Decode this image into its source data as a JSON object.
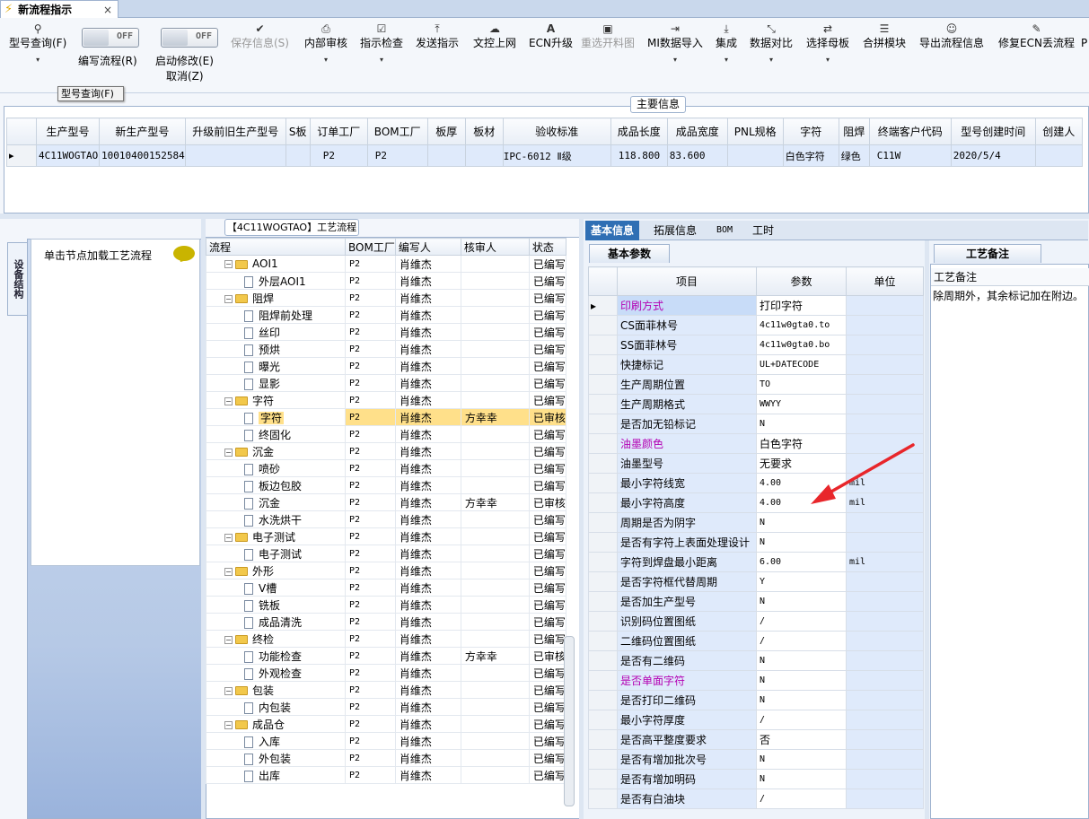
{
  "tab": {
    "title": "新流程指示",
    "close": "×"
  },
  "toolbar": {
    "query": {
      "label": "型号查询(F)",
      "icon": "search-icon"
    },
    "edit_flow": {
      "toggle": "OFF",
      "label": "编写流程(R)"
    },
    "start_modify": {
      "toggle": "OFF",
      "label": "启动修改(E)",
      "label2": "取消(Z)"
    },
    "buttons": [
      {
        "label": "保存信息(S)",
        "icon": "check-icon",
        "disabled": true
      },
      {
        "label": "内部审核",
        "icon": "print-icon"
      },
      {
        "label": "指示检查",
        "icon": "checkbox-icon"
      },
      {
        "label": "发送指示",
        "icon": "upload-icon"
      },
      {
        "label": "文控上网",
        "icon": "cloud-upload-icon"
      },
      {
        "label": "ECN升级",
        "icon": "text-icon"
      },
      {
        "label": "重选开料图",
        "icon": "image-icon",
        "disabled": true
      },
      {
        "label": "MI数据导入",
        "icon": "import-icon"
      },
      {
        "label": "集成",
        "icon": "download-icon"
      },
      {
        "label": "数据对比",
        "icon": "compress-icon"
      },
      {
        "label": "选择母板",
        "icon": "shuffle-icon"
      },
      {
        "label": "合拼模块",
        "icon": "list-icon"
      },
      {
        "label": "导出流程信息",
        "icon": "smile-icon"
      },
      {
        "label": "修复ECN丢流程",
        "icon": "wrench-icon"
      },
      {
        "label": "P",
        "icon": "more-icon"
      }
    ],
    "dropdown": "▾",
    "tooltip": "型号查询(F)"
  },
  "main_info": {
    "title": "主要信息",
    "columns": [
      "生产型号",
      "新生产型号",
      "升级前旧生产型号",
      "S板",
      "订单工厂",
      "BOM工厂",
      "板厚",
      "板材",
      "验收标准",
      "成品长度",
      "成品宽度",
      "PNL规格",
      "字符",
      "阻焊",
      "终端客户代码",
      "型号创建时间",
      "创建人"
    ],
    "row": [
      "4C11WOGTAO",
      "10010400152584",
      "",
      "",
      "P2",
      "P2",
      "",
      "",
      "IPC-6012 Ⅱ级",
      "118.800",
      "83.600",
      "",
      "白色字符",
      "绿色",
      "C11W",
      "2020/5/4",
      ""
    ]
  },
  "left_panel": {
    "vertical_tab": "设备结构",
    "hint": "单击节点加载工艺流程"
  },
  "flow": {
    "title": "【4C11WOGTAO】工艺流程",
    "columns": [
      "流程",
      "BOM工厂",
      "编写人",
      "核审人",
      "状态"
    ],
    "rows": [
      {
        "name": "AOI1",
        "level": 0,
        "factory": "P2",
        "author": "肖维杰",
        "reviewer": "",
        "status": "已编写"
      },
      {
        "name": "外层AOI1",
        "level": 1,
        "factory": "P2",
        "author": "肖维杰",
        "reviewer": "",
        "status": "已编写"
      },
      {
        "name": "阻焊",
        "level": 0,
        "factory": "P2",
        "author": "肖维杰",
        "reviewer": "",
        "status": "已编写"
      },
      {
        "name": "阻焊前处理",
        "level": 1,
        "factory": "P2",
        "author": "肖维杰",
        "reviewer": "",
        "status": "已编写"
      },
      {
        "name": "丝印",
        "level": 1,
        "factory": "P2",
        "author": "肖维杰",
        "reviewer": "",
        "status": "已编写"
      },
      {
        "name": "预烘",
        "level": 1,
        "factory": "P2",
        "author": "肖维杰",
        "reviewer": "",
        "status": "已编写"
      },
      {
        "name": "曝光",
        "level": 1,
        "factory": "P2",
        "author": "肖维杰",
        "reviewer": "",
        "status": "已编写"
      },
      {
        "name": "显影",
        "level": 1,
        "factory": "P2",
        "author": "肖维杰",
        "reviewer": "",
        "status": "已编写"
      },
      {
        "name": "字符",
        "level": 0,
        "factory": "P2",
        "author": "肖维杰",
        "reviewer": "",
        "status": "已编写"
      },
      {
        "name": "字符",
        "level": 1,
        "factory": "P2",
        "author": "肖维杰",
        "reviewer": "方幸幸",
        "status": "已审核",
        "selected": true
      },
      {
        "name": "终固化",
        "level": 1,
        "factory": "P2",
        "author": "肖维杰",
        "reviewer": "",
        "status": "已编写"
      },
      {
        "name": "沉金",
        "level": 0,
        "factory": "P2",
        "author": "肖维杰",
        "reviewer": "",
        "status": "已编写"
      },
      {
        "name": "喷砂",
        "level": 1,
        "factory": "P2",
        "author": "肖维杰",
        "reviewer": "",
        "status": "已编写"
      },
      {
        "name": "板边包胶",
        "level": 1,
        "factory": "P2",
        "author": "肖维杰",
        "reviewer": "",
        "status": "已编写"
      },
      {
        "name": "沉金",
        "level": 1,
        "factory": "P2",
        "author": "肖维杰",
        "reviewer": "方幸幸",
        "status": "已审核"
      },
      {
        "name": "水洗烘干",
        "level": 1,
        "factory": "P2",
        "author": "肖维杰",
        "reviewer": "",
        "status": "已编写"
      },
      {
        "name": "电子测试",
        "level": 0,
        "factory": "P2",
        "author": "肖维杰",
        "reviewer": "",
        "status": "已编写"
      },
      {
        "name": "电子测试",
        "level": 1,
        "factory": "P2",
        "author": "肖维杰",
        "reviewer": "",
        "status": "已编写"
      },
      {
        "name": "外形",
        "level": 0,
        "factory": "P2",
        "author": "肖维杰",
        "reviewer": "",
        "status": "已编写"
      },
      {
        "name": "V槽",
        "level": 1,
        "factory": "P2",
        "author": "肖维杰",
        "reviewer": "",
        "status": "已编写"
      },
      {
        "name": "铣板",
        "level": 1,
        "factory": "P2",
        "author": "肖维杰",
        "reviewer": "",
        "status": "已编写"
      },
      {
        "name": "成品清洗",
        "level": 1,
        "factory": "P2",
        "author": "肖维杰",
        "reviewer": "",
        "status": "已编写"
      },
      {
        "name": "终检",
        "level": 0,
        "factory": "P2",
        "author": "肖维杰",
        "reviewer": "",
        "status": "已编写"
      },
      {
        "name": "功能检查",
        "level": 1,
        "factory": "P2",
        "author": "肖维杰",
        "reviewer": "方幸幸",
        "status": "已审核"
      },
      {
        "name": "外观检查",
        "level": 1,
        "factory": "P2",
        "author": "肖维杰",
        "reviewer": "",
        "status": "已编写"
      },
      {
        "name": "包装",
        "level": 0,
        "factory": "P2",
        "author": "肖维杰",
        "reviewer": "",
        "status": "已编写"
      },
      {
        "name": "内包装",
        "level": 1,
        "factory": "P2",
        "author": "肖维杰",
        "reviewer": "",
        "status": "已编写"
      },
      {
        "name": "成品仓",
        "level": 0,
        "factory": "P2",
        "author": "肖维杰",
        "reviewer": "",
        "status": "已编写"
      },
      {
        "name": "入库",
        "level": 1,
        "factory": "P2",
        "author": "肖维杰",
        "reviewer": "",
        "status": "已编写"
      },
      {
        "name": "外包装",
        "level": 1,
        "factory": "P2",
        "author": "肖维杰",
        "reviewer": "",
        "status": "已编写"
      },
      {
        "name": "出库",
        "level": 1,
        "factory": "P2",
        "author": "肖维杰",
        "reviewer": "",
        "status": "已编写"
      }
    ]
  },
  "right_panel": {
    "tabs": [
      "基本信息",
      "拓展信息",
      "BOM",
      "工时"
    ],
    "basic_title": "基本参数",
    "columns": [
      "项目",
      "参数",
      "单位"
    ],
    "params": [
      {
        "item": "印刷方式",
        "value": "打印字符",
        "unit": "",
        "highlight": true,
        "current": true
      },
      {
        "item": "CS面菲林号",
        "value": "4c11w0gta0.to",
        "unit": "",
        "mono": true
      },
      {
        "item": "SS面菲林号",
        "value": "4c11w0gta0.bo",
        "unit": "",
        "mono": true
      },
      {
        "item": "快捷标记",
        "value": "UL+DATECODE",
        "unit": "",
        "mono": true
      },
      {
        "item": "生产周期位置",
        "value": "TO",
        "unit": "",
        "mono": true
      },
      {
        "item": "生产周期格式",
        "value": "WWYY",
        "unit": "",
        "mono": true
      },
      {
        "item": "是否加无铅标记",
        "value": "N",
        "unit": "",
        "mono": true
      },
      {
        "item": "油墨颜色",
        "value": "白色字符",
        "unit": "",
        "highlight": true
      },
      {
        "item": "油墨型号",
        "value": "无要求",
        "unit": ""
      },
      {
        "item": "最小字符线宽",
        "value": "4.00",
        "unit": "mil",
        "mono": true
      },
      {
        "item": "最小字符高度",
        "value": "4.00",
        "unit": "mil",
        "mono": true
      },
      {
        "item": "周期是否为阴字",
        "value": "N",
        "unit": "",
        "mono": true
      },
      {
        "item": "是否有字符上表面处理设计",
        "value": "N",
        "unit": "",
        "mono": true
      },
      {
        "item": "字符到焊盘最小距离",
        "value": "6.00",
        "unit": "mil",
        "mono": true
      },
      {
        "item": "是否字符框代替周期",
        "value": "Y",
        "unit": "",
        "mono": true
      },
      {
        "item": "是否加生产型号",
        "value": "N",
        "unit": "",
        "mono": true
      },
      {
        "item": "识别码位置图纸",
        "value": "/",
        "unit": "",
        "mono": true
      },
      {
        "item": "二维码位置图纸",
        "value": "/",
        "unit": "",
        "mono": true
      },
      {
        "item": "是否有二维码",
        "value": "N",
        "unit": "",
        "mono": true
      },
      {
        "item": "是否单面字符",
        "value": "N",
        "unit": "",
        "mono": true,
        "highlight": true
      },
      {
        "item": "是否打印二维码",
        "value": "N",
        "unit": "",
        "mono": true
      },
      {
        "item": "最小字符厚度",
        "value": "/",
        "unit": "",
        "mono": true
      },
      {
        "item": "是否高平整度要求",
        "value": "否",
        "unit": ""
      },
      {
        "item": "是否有增加批次号",
        "value": "N",
        "unit": "",
        "mono": true
      },
      {
        "item": "是否有增加明码",
        "value": "N",
        "unit": "",
        "mono": true
      },
      {
        "item": "是否有白油块",
        "value": "/",
        "unit": "",
        "mono": true
      }
    ],
    "memo_title": "工艺备注",
    "memo_header": "工艺备注",
    "memo_text": "除周期外，其余标记加在附边。"
  },
  "colors": {
    "accent": "#2f6fb4",
    "highlight_text": "#b300b3",
    "selected_row": "#ffe08a",
    "annotation_arrow": "#e8262b"
  }
}
